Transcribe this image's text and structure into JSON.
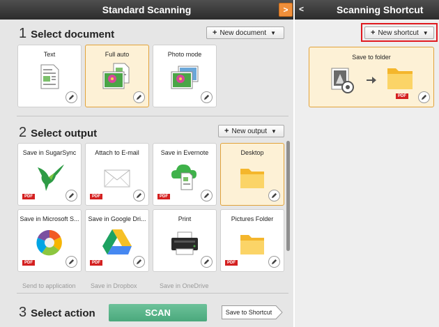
{
  "left_panel": {
    "header_title": "Standard Scanning",
    "collapse_glyph": ">"
  },
  "select_document": {
    "number": "1",
    "title": "Select document",
    "new_button": "New document",
    "cards": [
      {
        "label": "Text",
        "icon": "text-document-icon",
        "selected": false
      },
      {
        "label": "Full auto",
        "icon": "photo-document-icon",
        "selected": true
      },
      {
        "label": "Photo mode",
        "icon": "photo-mode-icon",
        "selected": false
      }
    ]
  },
  "select_output": {
    "number": "2",
    "title": "Select output",
    "new_button": "New output",
    "cards": [
      {
        "label": "Save in SugarSync",
        "icon": "sugarsync-hummingbird-icon",
        "pdf": true,
        "selected": false
      },
      {
        "label": "Attach to E-mail",
        "icon": "envelope-icon",
        "pdf": true,
        "selected": false
      },
      {
        "label": "Save in Evernote",
        "icon": "evernote-cloud-icon",
        "pdf": true,
        "selected": false
      },
      {
        "label": "Desktop",
        "icon": "folder-icon",
        "pdf": false,
        "selected": true
      },
      {
        "label": "Save in Microsoft S...",
        "icon": "microsoft-skydrive-icon",
        "pdf": true,
        "selected": false
      },
      {
        "label": "Save in Google Dri...",
        "icon": "google-drive-icon",
        "pdf": true,
        "selected": false
      },
      {
        "label": "Print",
        "icon": "printer-icon",
        "pdf": false,
        "selected": false
      },
      {
        "label": "Pictures Folder",
        "icon": "folder-icon",
        "pdf": true,
        "selected": false
      }
    ],
    "partial_labels": [
      "Send to application",
      "Save in Dropbox",
      "Save in OneDrive"
    ]
  },
  "select_action": {
    "number": "3",
    "title": "Select action",
    "scan_button": "SCAN",
    "shortcut_button": "Save to Shortcut"
  },
  "right_panel": {
    "header_title": "Scanning Shortcut",
    "expand_glyph": "<",
    "new_button": "New shortcut",
    "shortcut_card": {
      "label": "Save to folder",
      "pdf": true
    }
  },
  "badge_text": "PDF",
  "colors": {
    "header_bg": "#3a3a3a",
    "selected_bg": "#fdf1d6",
    "selected_border": "#e1a23a",
    "scan_green": "#5bb78c",
    "highlight_red": "#e0191f",
    "pdf_red": "#d42020"
  }
}
